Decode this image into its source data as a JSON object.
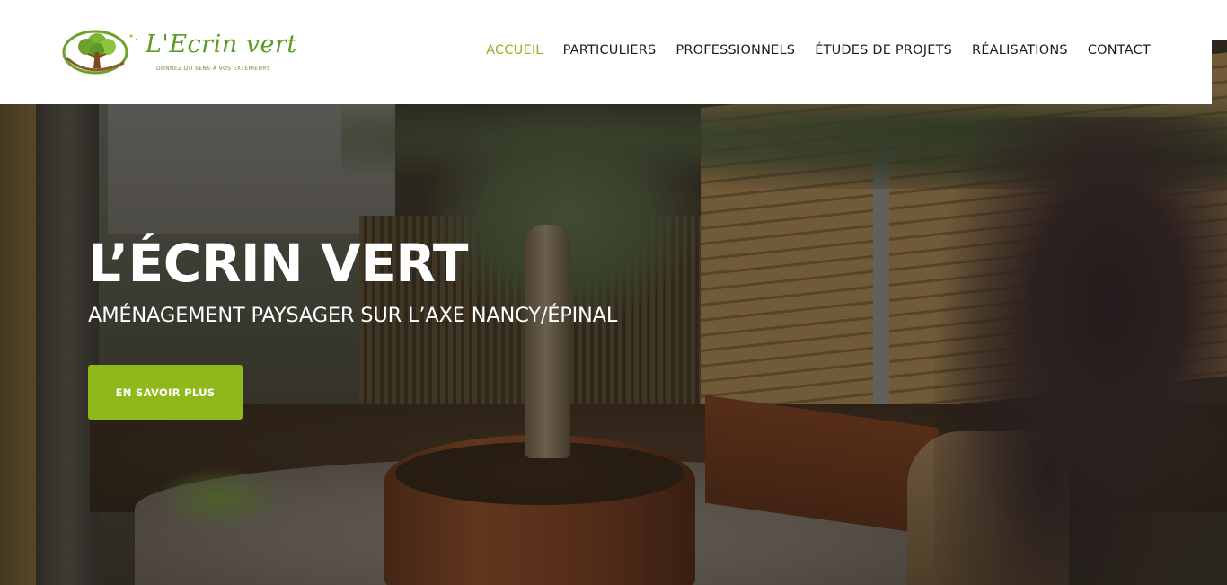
{
  "brand": {
    "name": "L'Ecrin vert",
    "tagline": "DONNEZ DU SENS À VOS EXTÉRIEURS",
    "accent_color": "#8ab81d"
  },
  "nav": {
    "items": [
      {
        "label": "ACCUEIL",
        "active": true
      },
      {
        "label": "PARTICULIERS",
        "active": false
      },
      {
        "label": "PROFESSIONNELS",
        "active": false
      },
      {
        "label": "ÉTUDES DE PROJETS",
        "active": false
      },
      {
        "label": "RÉALISATIONS",
        "active": false
      },
      {
        "label": "CONTACT",
        "active": false
      }
    ]
  },
  "hero": {
    "title": "L’ÉCRIN VERT",
    "subtitle": "AMÉNAGEMENT PAYSAGER SUR L’AXE NANCY/ÉPINAL",
    "cta_label": "EN SAVOIR PLUS",
    "cta_color": "#8fb81a"
  }
}
